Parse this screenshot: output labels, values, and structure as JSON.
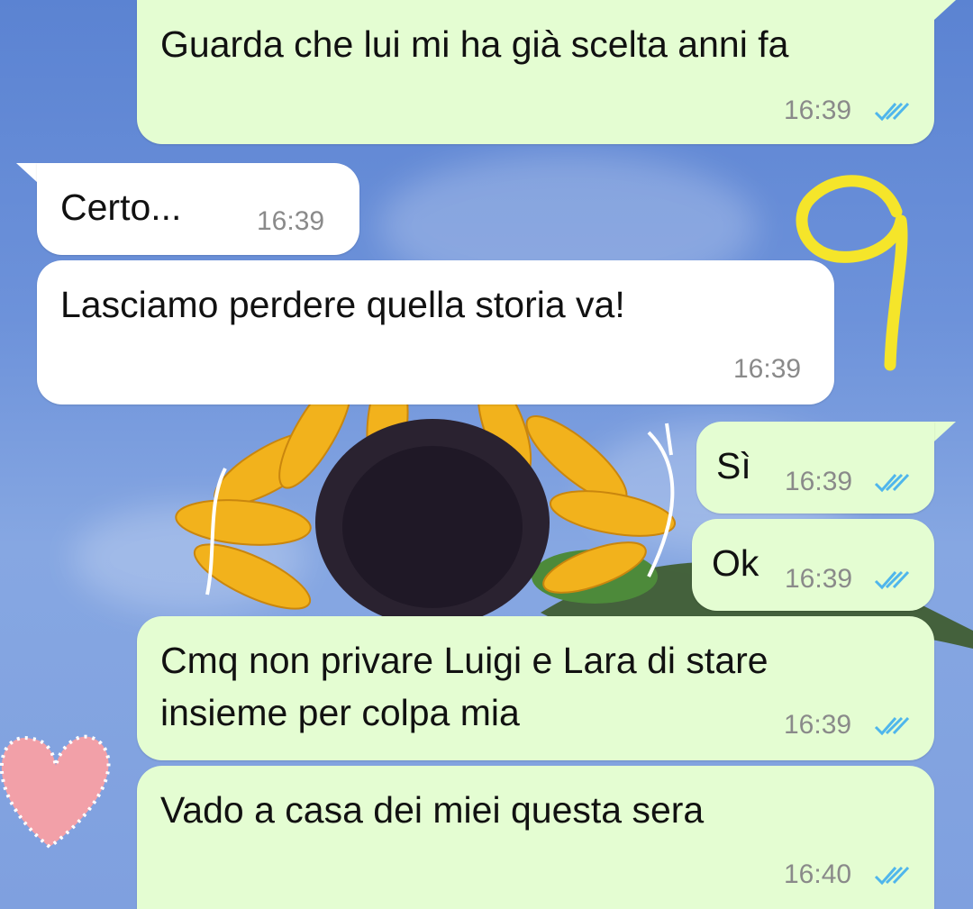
{
  "colors": {
    "outgoing_bubble": "#e4fdd2",
    "incoming_bubble": "#ffffff",
    "timestamp": "#8a8a8a",
    "read_receipt": "#4fb6ec",
    "annotation": "#f5e52a"
  },
  "messages": [
    {
      "direction": "outgoing",
      "text": "Guarda che lui mi ha già scelta anni fa",
      "time": "16:39",
      "status": "read"
    },
    {
      "direction": "incoming",
      "text": "Certo...",
      "time": "16:39"
    },
    {
      "direction": "incoming",
      "text": "Lasciamo perdere quella storia va!",
      "time": "16:39"
    },
    {
      "direction": "outgoing",
      "text": "Sì",
      "time": "16:39",
      "status": "read"
    },
    {
      "direction": "outgoing",
      "text": "Ok",
      "time": "16:39",
      "status": "read"
    },
    {
      "direction": "outgoing",
      "text_line1": "Cmq non privare Luigi e Lara di stare",
      "text_line2": "insieme per colpa mia",
      "time": "16:39",
      "status": "read"
    },
    {
      "direction": "outgoing",
      "text": "Vado a casa dei miei questa sera",
      "time": "16:40",
      "status": "read"
    }
  ],
  "annotation": {
    "text": "9"
  },
  "icons": {
    "read_receipt": "double-check-icon",
    "wallpaper": "sunflower",
    "sticker": "heart"
  }
}
